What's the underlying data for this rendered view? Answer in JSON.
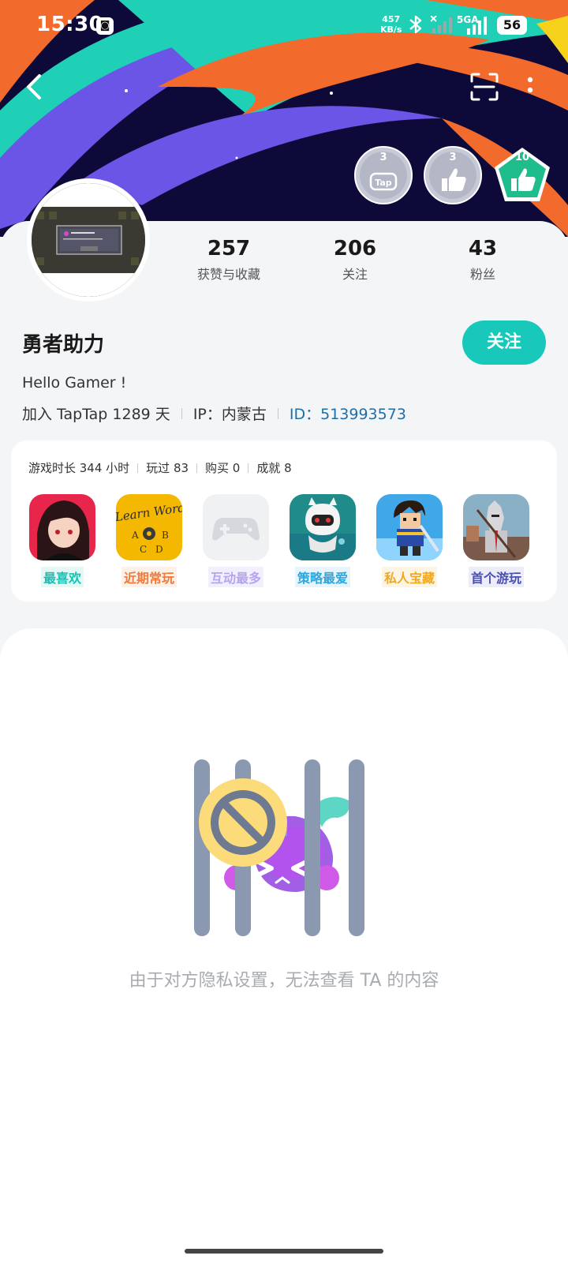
{
  "status_bar": {
    "time": "15:30",
    "net_speed_value": "457",
    "net_speed_unit": "KB/s",
    "network_type": "5GA",
    "battery": "56"
  },
  "badges": [
    {
      "count": "3",
      "name": "badge-tap"
    },
    {
      "count": "3",
      "name": "badge-thumb"
    },
    {
      "count": "10",
      "name": "badge-thumb-gold"
    }
  ],
  "stats": [
    {
      "value": "257",
      "label": "获赞与收藏"
    },
    {
      "value": "206",
      "label": "关注"
    },
    {
      "value": "43",
      "label": "粉丝"
    }
  ],
  "profile": {
    "name": "勇者助力",
    "follow_label": "关注",
    "bio": "Hello Gamer !",
    "joined": "加入 TapTap 1289 天",
    "ip": "IP：内蒙古",
    "id": "ID：513993573"
  },
  "game_stats": {
    "playtime": "游戏时长 344 小时",
    "played": "玩过 83",
    "bought": "购买 0",
    "achievements": "成就 8"
  },
  "games": [
    {
      "label": "最喜欢",
      "color": "#14c2b4"
    },
    {
      "label": "近期常玩",
      "color": "#f07a3a"
    },
    {
      "label": "互动最多",
      "color": "#b6a4ef"
    },
    {
      "label": "策略最爱",
      "color": "#2aa8e0"
    },
    {
      "label": "私人宝藏",
      "color": "#f2a81e"
    },
    {
      "label": "首个游玩",
      "color": "#4a4fb5"
    }
  ],
  "privacy_message": "由于对方隐私设置，无法查看 TA 的内容",
  "colors": {
    "accent": "#18c8bb",
    "hero_bg": "#0d0a3a"
  }
}
